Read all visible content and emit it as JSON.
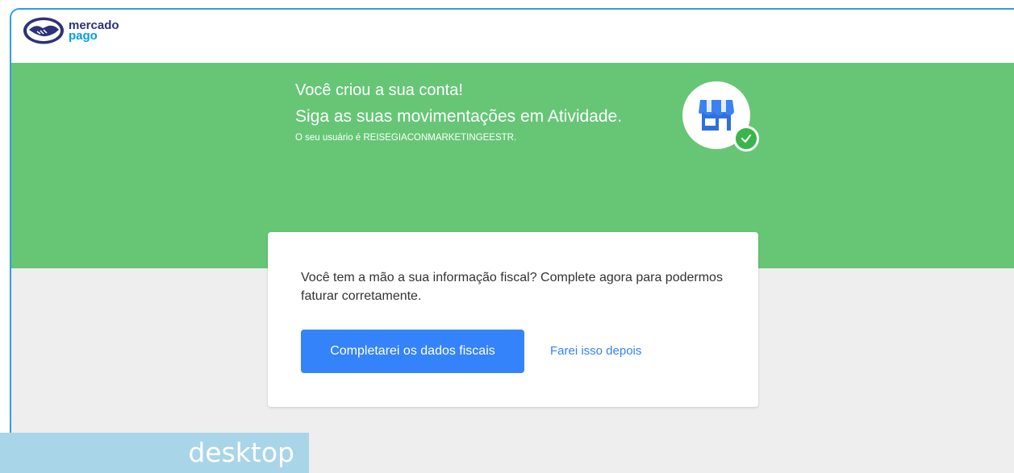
{
  "header": {
    "logo_line1": "mercado",
    "logo_line2": "pago"
  },
  "hero": {
    "title": "Você criou a sua conta!",
    "subtitle": "Siga as suas movimentações em Atividade.",
    "user_line": "O seu usuário é REISEGIACONMARKETINGEESTR.",
    "badge_icon": "store-icon",
    "check_icon": "check-icon"
  },
  "card": {
    "message": "Você tem a mão a sua informação fiscal? Complete agora para podermos faturar corretamente.",
    "primary_label": "Completarei os dados fiscais",
    "secondary_label": "Farei isso depois"
  },
  "watermark": {
    "label": "desktop"
  },
  "colors": {
    "hero_green": "#66c676",
    "primary_blue": "#3483fa",
    "check_green": "#39b54a",
    "frame_border": "#2e9fd8"
  }
}
